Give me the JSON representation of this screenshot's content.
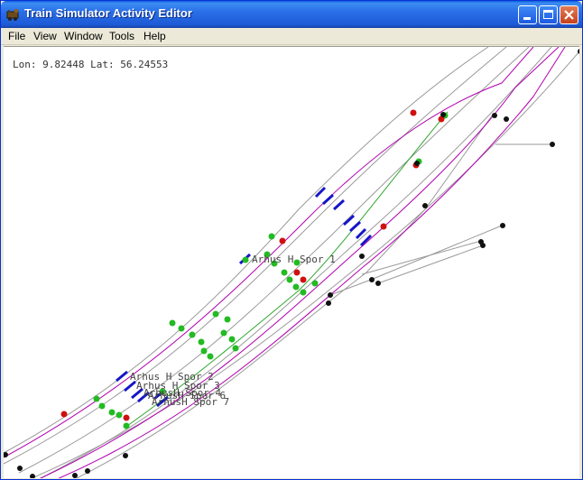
{
  "window": {
    "title": "Train Simulator Activity Editor"
  },
  "menu": {
    "items": [
      "File",
      "View",
      "Window",
      "Tools",
      "Help"
    ]
  },
  "status": {
    "coords": "Lon: 9.82448 Lat: 56.24553"
  },
  "map": {
    "labels": [
      "Arhus H  Spor 1",
      "Arhus H Spor 2",
      "Arhus H Spor 3",
      "ArhusH Spor 6",
      "ArhusH Spor 7",
      "ArhusH Spor 4"
    ]
  },
  "colors": {
    "title_blue": "#245edb",
    "track_gray": "#9a9a9a",
    "path_magenta": "#b000b0",
    "path_green": "#2ea82e",
    "signal_red": "#d01010",
    "signal_green": "#22bb22",
    "marker_blue": "#1515c8",
    "node_black": "#111111"
  }
}
